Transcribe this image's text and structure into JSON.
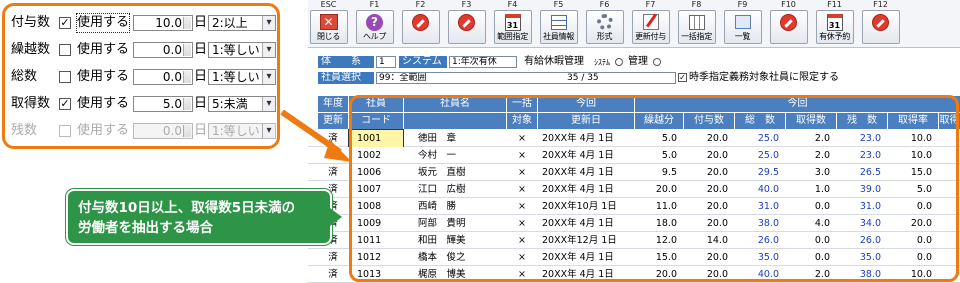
{
  "toolbar": {
    "keys": [
      {
        "fkey": "ESC",
        "label": "閉じる",
        "icon": "close-icon"
      },
      {
        "fkey": "F1",
        "label": "ヘルプ",
        "icon": "help-icon"
      },
      {
        "fkey": "F2",
        "label": "",
        "icon": "no-entry-icon"
      },
      {
        "fkey": "F3",
        "label": "",
        "icon": "no-entry-icon"
      },
      {
        "fkey": "F4",
        "label": "範囲指定",
        "icon": "calendar-icon"
      },
      {
        "fkey": "F5",
        "label": "社員情報",
        "icon": "employee-grid-icon"
      },
      {
        "fkey": "F6",
        "label": "形式",
        "icon": "gear-icon"
      },
      {
        "fkey": "F7",
        "label": "更新付与",
        "icon": "edit-icon"
      },
      {
        "fkey": "F8",
        "label": "一括指定",
        "icon": "batch-grid-icon"
      },
      {
        "fkey": "F9",
        "label": "一覧",
        "icon": "list-icon"
      },
      {
        "fkey": "F10",
        "label": "",
        "icon": "no-entry-icon"
      },
      {
        "fkey": "F11",
        "label": "有休予約",
        "icon": "calendar-icon"
      },
      {
        "fkey": "F12",
        "label": "",
        "icon": "no-entry-icon"
      }
    ],
    "cal_day": "31"
  },
  "fields": {
    "tai_label": "体　　系",
    "tai_value": "1",
    "system_label": "システム",
    "system_value": "1:年次有休",
    "kyuka_label": "有給休暇管理",
    "sys_small": "ｼｽﾃﾑ",
    "kanri_label": "管理",
    "emp_label": "社員選択",
    "emp_value": "99：全範囲",
    "count": "35 / 35",
    "limit_label": "時季指定義務対象社員に限定する",
    "limit_checked": "✓"
  },
  "table": {
    "headers_top": [
      "年度",
      "社員",
      "社員名",
      "一括",
      "今回",
      "今回"
    ],
    "headers_bottom": [
      "更新",
      "コード",
      "",
      "対象",
      "更新日",
      "繰越分",
      "付与数",
      "総　数",
      "取得数",
      "残　数",
      "取得率",
      "取得"
    ],
    "rows": [
      {
        "status": "済",
        "code": "1001",
        "name": "徳田　章",
        "target": "×",
        "date": "20XX年 4月 1日",
        "kurikoshi": "5.0",
        "fuyo": "20.0",
        "total": "25.0",
        "taken": "2.0",
        "remain": "23.0",
        "rate": "10.0",
        "extra": ""
      },
      {
        "status": "済",
        "code": "1002",
        "name": "今村　一",
        "target": "×",
        "date": "20XX年 4月 1日",
        "kurikoshi": "5.0",
        "fuyo": "20.0",
        "total": "25.0",
        "taken": "2.0",
        "remain": "23.0",
        "rate": "10.0",
        "extra": ""
      },
      {
        "status": "済",
        "code": "1006",
        "name": "坂元　直樹",
        "target": "×",
        "date": "20XX年 4月 1日",
        "kurikoshi": "9.5",
        "fuyo": "20.0",
        "total": "29.5",
        "taken": "3.0",
        "remain": "26.5",
        "rate": "15.0",
        "extra": ""
      },
      {
        "status": "済",
        "code": "1007",
        "name": "江口　広樹",
        "target": "×",
        "date": "20XX年 4月 1日",
        "kurikoshi": "20.0",
        "fuyo": "20.0",
        "total": "40.0",
        "taken": "1.0",
        "remain": "39.0",
        "rate": "5.0",
        "extra": ""
      },
      {
        "status": "済",
        "code": "1008",
        "name": "西崎　勝",
        "target": "×",
        "date": "20XX年10月 1日",
        "kurikoshi": "11.0",
        "fuyo": "20.0",
        "total": "31.0",
        "taken": "0.0",
        "remain": "31.0",
        "rate": "0.0",
        "extra": ""
      },
      {
        "status": "済",
        "code": "1009",
        "name": "阿部　貴明",
        "target": "×",
        "date": "20XX年 4月 1日",
        "kurikoshi": "18.0",
        "fuyo": "20.0",
        "total": "38.0",
        "taken": "4.0",
        "remain": "34.0",
        "rate": "20.0",
        "extra": ""
      },
      {
        "status": "済",
        "code": "1011",
        "name": "和田　輝美",
        "target": "×",
        "date": "20XX年12月 1日",
        "kurikoshi": "12.0",
        "fuyo": "14.0",
        "total": "26.0",
        "taken": "0.0",
        "remain": "26.0",
        "rate": "0.0",
        "extra": ""
      },
      {
        "status": "済",
        "code": "1012",
        "name": "橋本　俊之",
        "target": "×",
        "date": "20XX年 4月 1日",
        "kurikoshi": "15.0",
        "fuyo": "20.0",
        "total": "35.0",
        "taken": "0.0",
        "remain": "35.0",
        "rate": "0.0",
        "extra": ""
      },
      {
        "status": "済",
        "code": "1013",
        "name": "梶原　博美",
        "target": "×",
        "date": "20XX年 4月 1日",
        "kurikoshi": "20.0",
        "fuyo": "20.0",
        "total": "40.0",
        "taken": "2.0",
        "remain": "38.0",
        "rate": "10.0",
        "extra": ""
      }
    ]
  },
  "popup": {
    "rows": [
      {
        "label": "付与数",
        "checked": "✓",
        "enable": "使用する",
        "value": "10.0",
        "day": "日",
        "cond": "2:以上",
        "disabled": false
      },
      {
        "label": "繰越数",
        "checked": "",
        "enable": "使用する",
        "value": "0.0",
        "day": "日",
        "cond": "1:等しい",
        "disabled": false
      },
      {
        "label": "総数",
        "checked": "",
        "enable": "使用する",
        "value": "0.0",
        "day": "日",
        "cond": "1:等しい",
        "disabled": false
      },
      {
        "label": "取得数",
        "checked": "✓",
        "enable": "使用する",
        "value": "5.0",
        "day": "日",
        "cond": "5:未満",
        "disabled": false
      },
      {
        "label": "残数",
        "checked": "",
        "enable": "使用する",
        "value": "0.0",
        "day": "日",
        "cond": "1:等しい",
        "disabled": true
      }
    ]
  },
  "callout": {
    "line1": "付与数10日以上、取得数5日未満の",
    "line2": "労働者を抽出する場合"
  },
  "colors": {
    "accent": "#f07a12",
    "header_blue": "#4c7fc0",
    "callout_green": "#2e9447",
    "value_blue": "#1d3fbd"
  }
}
